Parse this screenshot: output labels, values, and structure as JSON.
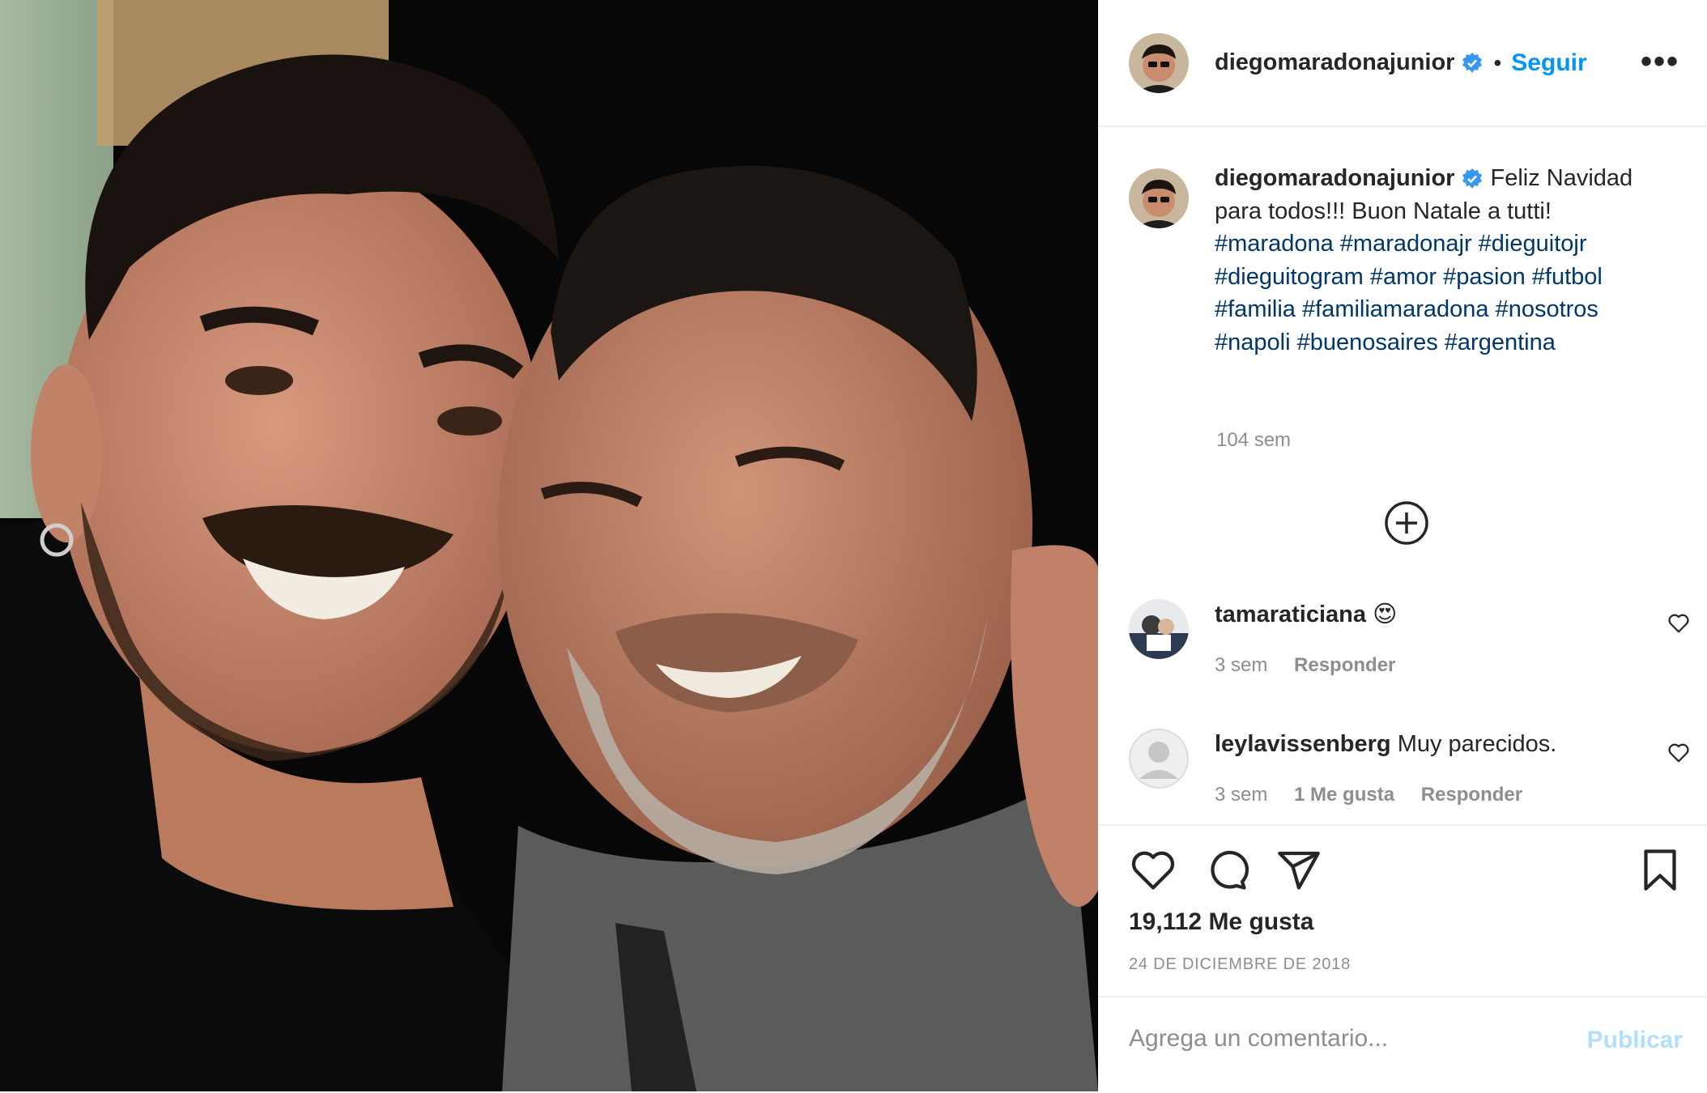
{
  "post": {
    "author": "diegomaradonajunior",
    "separator": "•",
    "follow_label": "Seguir",
    "more_label": "•••"
  },
  "caption": {
    "username": "diegomaradonajunior",
    "text_prefix": "Feliz Navidad para todos!!! Buon Natale a tutti!",
    "hashtags": [
      "#maradona",
      "#maradonajr",
      "#dieguitojr",
      "#dieguitogram",
      "#amor",
      "#pasion",
      "#futbol",
      "#familia",
      "#familiamaradona",
      "#nosotros",
      "#napoli",
      "#buenosaires",
      "#argentina"
    ],
    "time": "104 sem"
  },
  "comments": [
    {
      "username": "tamaraticiana",
      "text": "😍",
      "time": "3 sem",
      "likes": "",
      "reply_label": "Responder"
    },
    {
      "username": "leylavissenberg",
      "text": "Muy parecidos.",
      "time": "3 sem",
      "likes": "1 Me gusta",
      "reply_label": "Responder"
    }
  ],
  "engagement": {
    "likes_text": "19,112 Me gusta",
    "date": "24 DE DICIEMBRE DE 2018"
  },
  "comment_box": {
    "placeholder": "Agrega un comentario...",
    "publish_label": "Publicar"
  },
  "icons": {
    "verified": "verified-badge-icon",
    "add": "plus-circle-icon",
    "like": "heart-icon",
    "comment": "comment-bubble-icon",
    "share": "paper-plane-icon",
    "save": "bookmark-icon"
  },
  "colors": {
    "accent": "#0095f6",
    "hashtag": "#00376b",
    "muted": "#8e8e8e",
    "publish_disabled": "#b2dffc",
    "verified": "#3897f0"
  }
}
